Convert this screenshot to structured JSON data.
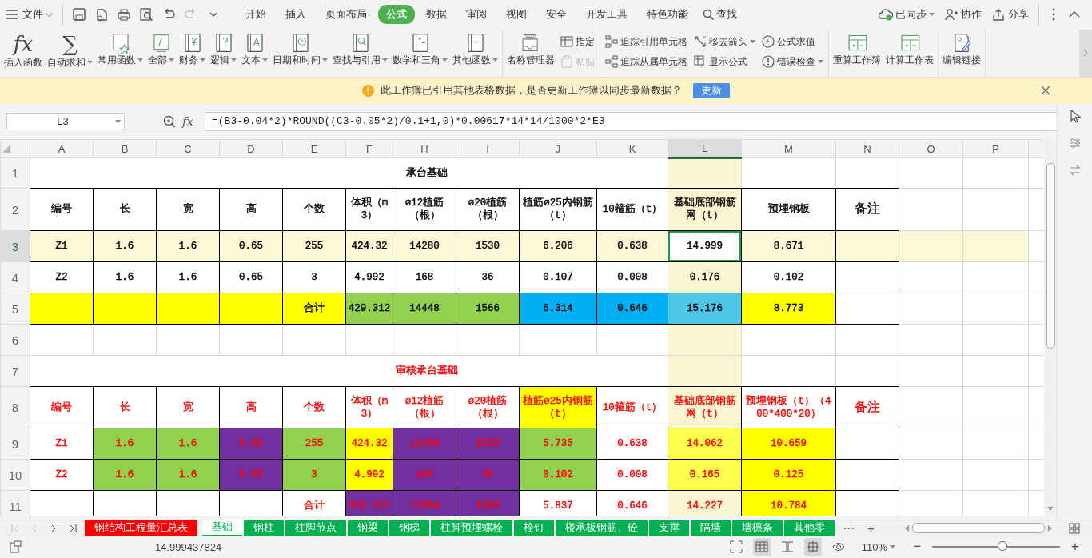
{
  "file_menu": {
    "label": "文件"
  },
  "menu_tabs": [
    {
      "label": "开始",
      "selected": false
    },
    {
      "label": "插入",
      "selected": false
    },
    {
      "label": "页面布局",
      "selected": false
    },
    {
      "label": "公式",
      "selected": true
    },
    {
      "label": "数据",
      "selected": false
    },
    {
      "label": "审阅",
      "selected": false
    },
    {
      "label": "视图",
      "selected": false
    },
    {
      "label": "安全",
      "selected": false
    },
    {
      "label": "开发工具",
      "selected": false
    },
    {
      "label": "特色功能",
      "selected": false
    }
  ],
  "search": {
    "label": "查找"
  },
  "account": [
    {
      "label": "已同步",
      "dropdown": true
    },
    {
      "label": "协作",
      "dropdown": false
    },
    {
      "label": "分享",
      "dropdown": false
    }
  ],
  "ribbon_groups": [
    [
      {
        "kind": "large",
        "label": "插入函数",
        "glyph": "fx",
        "dropdown": false
      },
      {
        "kind": "large",
        "label": "自动求和",
        "glyph": "∑",
        "dropdown": true
      },
      {
        "kind": "large",
        "label": "常用函数",
        "dropdown": true
      },
      {
        "kind": "large",
        "label": "全部",
        "dropdown": true
      },
      {
        "kind": "large",
        "label": "财务",
        "dropdown": true
      },
      {
        "kind": "large",
        "label": "逻辑",
        "dropdown": true
      },
      {
        "kind": "large",
        "label": "文本",
        "dropdown": true
      },
      {
        "kind": "large",
        "label": "日期和时间",
        "dropdown": true
      },
      {
        "kind": "large",
        "label": "查找与引用",
        "dropdown": true
      },
      {
        "kind": "large",
        "label": "数学和三角",
        "dropdown": true
      },
      {
        "kind": "large",
        "label": "其他函数",
        "dropdown": true
      }
    ],
    [
      {
        "kind": "large",
        "label": "名称管理器",
        "dropdown": false
      },
      {
        "kind": "stack",
        "items": [
          {
            "label": "指定",
            "dropdown": false,
            "disabled": false
          },
          {
            "label": "粘贴",
            "dropdown": false,
            "disabled": true
          }
        ]
      }
    ],
    [
      {
        "kind": "stack",
        "items": [
          {
            "label": "追踪引用单元格",
            "dropdown": false,
            "disabled": false
          },
          {
            "label": "追踪从属单元格",
            "dropdown": false,
            "disabled": false
          }
        ]
      },
      {
        "kind": "stack",
        "items": [
          {
            "label": "移去箭头",
            "dropdown": true,
            "disabled": false
          },
          {
            "label": "显示公式",
            "dropdown": false,
            "disabled": false
          }
        ]
      },
      {
        "kind": "stack",
        "items": [
          {
            "label": "公式求值",
            "dropdown": false,
            "disabled": false
          },
          {
            "label": "错误检查",
            "dropdown": true,
            "disabled": false
          }
        ]
      }
    ],
    [
      {
        "kind": "large",
        "label": "重算工作簿",
        "dropdown": false
      },
      {
        "kind": "large",
        "label": "计算工作表",
        "dropdown": false
      }
    ],
    [
      {
        "kind": "large",
        "label": "编辑链接",
        "dropdown": false
      }
    ]
  ],
  "notice": {
    "message": "此工作簿已引用其他表格数据，是否更新工作簿以同步最新数据？",
    "button": "更新"
  },
  "formula_bar": {
    "name_box": "L3",
    "fx": "fx",
    "formula": "=(B3-0.04*2)*ROUND((C3-0.05*2)/0.1+1,0)*0.00617*14*14/1000*2*E3"
  },
  "columns": [
    {
      "label": "A",
      "selected": false
    },
    {
      "label": "B",
      "selected": false
    },
    {
      "label": "C",
      "selected": false
    },
    {
      "label": "D",
      "selected": false
    },
    {
      "label": "E",
      "selected": false
    },
    {
      "label": "F",
      "selected": false
    },
    {
      "label": "H",
      "selected": false
    },
    {
      "label": "I",
      "selected": false
    },
    {
      "label": "J",
      "selected": false
    },
    {
      "label": "K",
      "selected": false
    },
    {
      "label": "L",
      "selected": true
    },
    {
      "label": "M",
      "selected": false
    },
    {
      "label": "N",
      "selected": false
    },
    {
      "label": "O",
      "selected": false
    },
    {
      "label": "P",
      "selected": false
    }
  ],
  "rows": [
    {
      "number": "1",
      "selected": false,
      "kind": "title",
      "color": "#000000",
      "title": "承台基础"
    },
    {
      "number": "2",
      "selected": false,
      "kind": "table",
      "color": "#000000",
      "cells": [
        {
          "text": "编号"
        },
        {
          "text": "长"
        },
        {
          "text": "宽"
        },
        {
          "text": "高"
        },
        {
          "text": "个数"
        },
        {
          "text": "体积（m3）"
        },
        {
          "text": "ø12植筋（根）"
        },
        {
          "text": "ø20植筋（根）"
        },
        {
          "text": "植筋ø25内钢筋（t）"
        },
        {
          "text": "10箍筋（t）"
        },
        {
          "text": "基础底部钢筋网（t）"
        },
        {
          "text": "预埋钢板"
        },
        {
          "text": "备注"
        }
      ]
    },
    {
      "number": "3",
      "selected": true,
      "kind": "table",
      "color": "#000000",
      "cells": [
        {
          "text": "Z1"
        },
        {
          "text": "1.6"
        },
        {
          "text": "1.6"
        },
        {
          "text": "0.65"
        },
        {
          "text": "255"
        },
        {
          "text": "424.32"
        },
        {
          "text": "14280"
        },
        {
          "text": "1530"
        },
        {
          "text": "6.206"
        },
        {
          "text": "0.638"
        },
        {
          "text": "14.999",
          "active": true
        },
        {
          "text": "8.671"
        },
        null
      ]
    },
    {
      "number": "4",
      "selected": false,
      "kind": "table",
      "color": "#000000",
      "cells": [
        {
          "text": "Z2"
        },
        {
          "text": "1.6"
        },
        {
          "text": "1.6"
        },
        {
          "text": "0.65"
        },
        {
          "text": "3"
        },
        {
          "text": "4.992"
        },
        {
          "text": "168"
        },
        {
          "text": "36"
        },
        {
          "text": "0.107"
        },
        {
          "text": "0.008"
        },
        {
          "text": "0.176"
        },
        {
          "text": "0.102"
        },
        null
      ]
    },
    {
      "number": "5",
      "selected": false,
      "kind": "table",
      "color": "#000000",
      "cells": [
        {
          "color": "#ffff00"
        },
        {
          "color": "#ffff00"
        },
        {
          "color": "#ffff00"
        },
        {
          "color": "#ffff00"
        },
        {
          "text": "合计",
          "color": "#ffff00"
        },
        {
          "text": "429.312",
          "color": "#92d050"
        },
        {
          "text": "14448",
          "color": "#92d050"
        },
        {
          "text": "1566",
          "color": "#92d050"
        },
        {
          "text": "6.314",
          "color": "#00b0f0"
        },
        {
          "text": "0.646",
          "color": "#00b0f0"
        },
        {
          "text": "15.176",
          "color": "#4fc6e6"
        },
        {
          "text": "8.773",
          "color": "#ffff00"
        },
        null
      ]
    },
    {
      "number": "6",
      "selected": false,
      "kind": "blank"
    },
    {
      "number": "7",
      "selected": false,
      "kind": "title",
      "color": "#ff0000",
      "title": "审核承台基础"
    },
    {
      "number": "8",
      "selected": false,
      "kind": "table",
      "color": "#ff0000",
      "cells": [
        {
          "text": "编号"
        },
        {
          "text": "长"
        },
        {
          "text": "宽"
        },
        {
          "text": "高"
        },
        {
          "text": "个数"
        },
        {
          "text": "体积（m3）"
        },
        {
          "text": "ø12植筋（根）"
        },
        {
          "text": "ø20植筋（根）"
        },
        {
          "text": "植筋ø25内钢筋（t）",
          "color": "#ffff00"
        },
        {
          "text": "10箍筋（t）"
        },
        {
          "text": "基础底部钢筋网（t）"
        },
        {
          "text": "预埋钢板（t）（400*400*20）"
        },
        {
          "text": "备注"
        }
      ]
    },
    {
      "number": "9",
      "selected": false,
      "kind": "table",
      "color": "#ff0000",
      "cells": [
        {
          "text": "Z1"
        },
        {
          "text": "1.6",
          "color": "#92d050"
        },
        {
          "text": "1.6",
          "color": "#92d050"
        },
        {
          "text": "0.65",
          "color": "#7030a0"
        },
        {
          "text": "255",
          "color": "#92d050"
        },
        {
          "text": "424.32",
          "color": "#ffff00"
        },
        {
          "text": "12240",
          "color": "#7030a0"
        },
        {
          "text": "1530",
          "color": "#7030a0"
        },
        {
          "text": "5.735",
          "color": "#92d050"
        },
        {
          "text": "0.638"
        },
        {
          "text": "14.062",
          "color": "#ffff4d"
        },
        {
          "text": "10.659",
          "color": "#ffff00"
        },
        null
      ]
    },
    {
      "number": "10",
      "selected": false,
      "kind": "table",
      "color": "#ff0000",
      "cells": [
        {
          "text": "Z2"
        },
        {
          "text": "1.6",
          "color": "#92d050"
        },
        {
          "text": "1.6",
          "color": "#92d050"
        },
        {
          "text": "0.65",
          "color": "#7030a0"
        },
        {
          "text": "3",
          "color": "#92d050"
        },
        {
          "text": "4.992",
          "color": "#ffff00"
        },
        {
          "text": "144",
          "color": "#7030a0"
        },
        {
          "text": "36",
          "color": "#7030a0"
        },
        {
          "text": "0.102",
          "color": "#92d050"
        },
        {
          "text": "0.008"
        },
        {
          "text": "0.165",
          "color": "#ffff4d"
        },
        {
          "text": "0.125",
          "color": "#ffff00"
        },
        null
      ]
    },
    {
      "number": "11",
      "selected": false,
      "kind": "table",
      "color": "#ff0000",
      "cells": [
        null,
        null,
        null,
        null,
        {
          "text": "合计"
        },
        {
          "text": "429.312",
          "color": "#7030a0"
        },
        {
          "text": "12384",
          "color": "#7030a0"
        },
        {
          "text": "1566",
          "color": "#7030a0"
        },
        {
          "text": "5.837"
        },
        {
          "text": "0.646"
        },
        {
          "text": "14.227"
        },
        {
          "text": "10.784",
          "color": "#ffff00"
        },
        null
      ]
    }
  ],
  "sheet_tabs": [
    {
      "label": "钢结构工程量汇总表",
      "color": "#ff0000",
      "selected": false
    },
    {
      "label": "基础",
      "color": "#00b050",
      "selected": true
    },
    {
      "label": "钢柱",
      "color": "#00b050",
      "selected": false
    },
    {
      "label": "柱脚节点",
      "color": "#00b050",
      "selected": false
    },
    {
      "label": "钢梁",
      "color": "#00b050",
      "selected": false
    },
    {
      "label": "钢梯",
      "color": "#00b050",
      "selected": false
    },
    {
      "label": "柱脚预埋螺栓",
      "color": "#00b050",
      "selected": false
    },
    {
      "label": "栓钉",
      "color": "#00b050",
      "selected": false
    },
    {
      "label": "楼承板钢筋、砼",
      "color": "#00b050",
      "selected": false
    },
    {
      "label": "支撑",
      "color": "#00b050",
      "selected": false
    },
    {
      "label": "隔墙",
      "color": "#00b050",
      "selected": false
    },
    {
      "label": "墙檩条",
      "color": "#00b050",
      "selected": false
    },
    {
      "label": "其他零",
      "color": "#00b050",
      "selected": false
    }
  ],
  "more_tabs": "⋯",
  "add_tab": "+",
  "status_bar": {
    "value": "14.999437824",
    "zoom": "110%",
    "zoom_level": {
      "level": 0.55
    },
    "minus": "−",
    "plus": "+"
  }
}
